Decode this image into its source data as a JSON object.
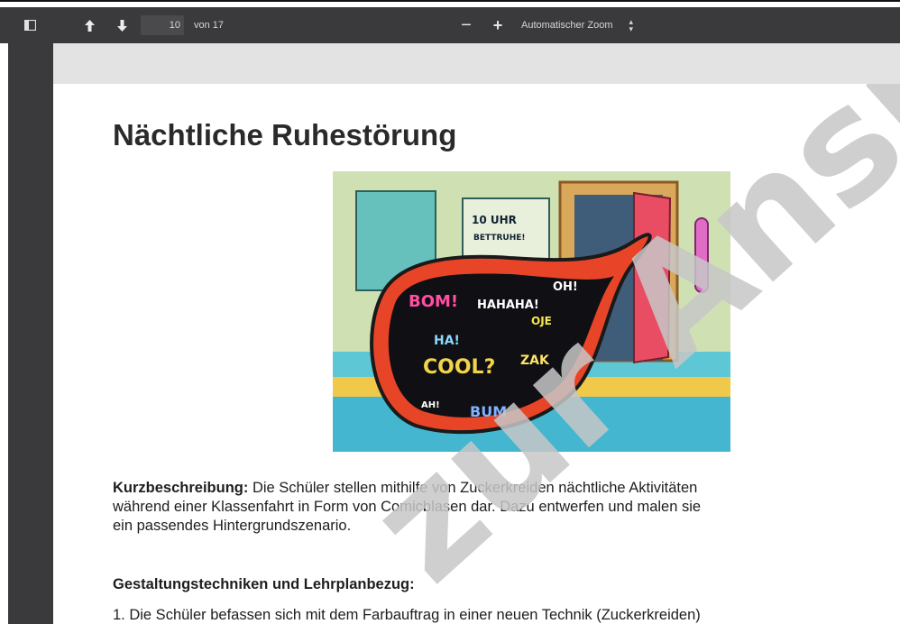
{
  "toolbar": {
    "current_page": "10",
    "page_total": "von 17",
    "zoom_minus": "−",
    "zoom_plus": "+",
    "zoom_label": "Automatischer Zoom"
  },
  "document": {
    "title": "Nächtliche Ruhestörung",
    "illustration_texts": [
      "10 UHR BETTRUHE!",
      "BOM!",
      "HAHAHA!",
      "OH!",
      "HA!",
      "COOL?",
      "ZAK",
      "BUM",
      "AH!",
      "OJE"
    ],
    "description_label": "Kurzbeschreibung:",
    "description_lines": [
      " Die Schüler stellen mithilfe von Zuckerkreiden nächtliche Aktivitäten",
      "während einer Klassenfahrt in Form von Comicblasen dar. Dazu entwerfen und malen sie",
      "ein passendes Hintergrundszenario."
    ],
    "section_heading": "Gestaltungstechniken und Lehrplanbezug:",
    "list_item_1": "1. Die Schüler befassen sich mit dem Farbauftrag in einer neuen Technik (Zuckerkreiden)",
    "watermark": "zur Ansicht"
  },
  "colors": {
    "toolbar_bg": "#3a3a3c",
    "toolbar_text": "#d6d6d6",
    "viewer_bar": "#e3e3e3",
    "watermark": "#c7c7c7"
  },
  "icons": [
    "sidebar-toggle-icon",
    "arrow-up-icon",
    "arrow-down-icon",
    "zoom-select-arrows-icon"
  ]
}
